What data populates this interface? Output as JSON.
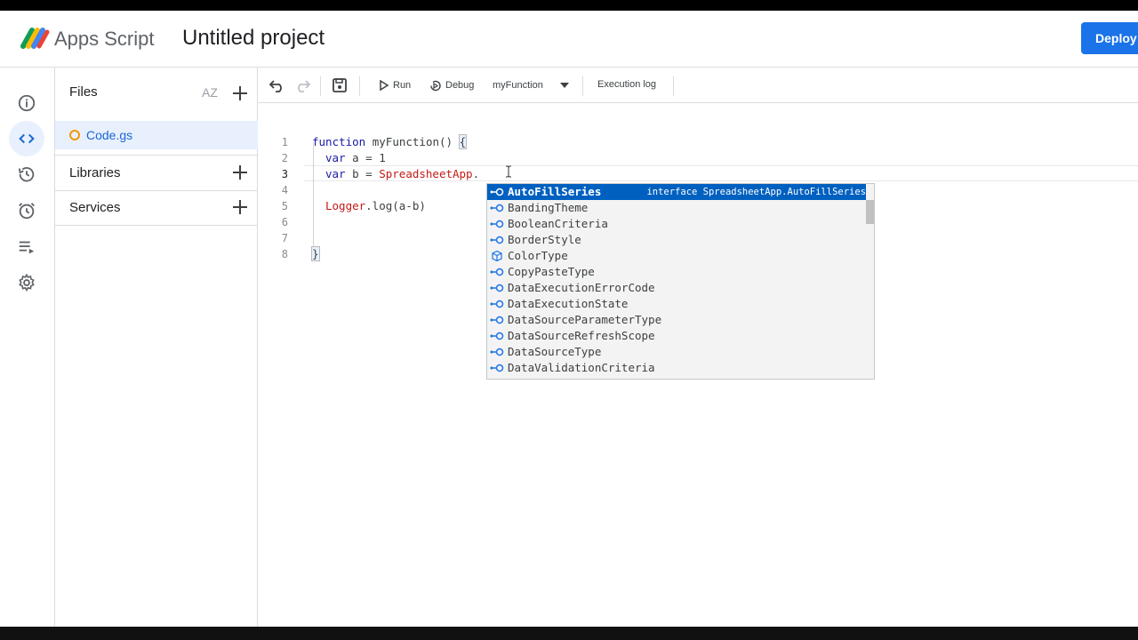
{
  "header": {
    "app_name": "Apps Script",
    "project_title": "Untitled project",
    "deploy_label": "Deploy"
  },
  "rail": {
    "items": [
      {
        "icon": "info-icon"
      },
      {
        "icon": "code-icon",
        "active": true
      },
      {
        "icon": "history-icon"
      },
      {
        "icon": "alarm-icon"
      },
      {
        "icon": "executions-icon"
      },
      {
        "icon": "gear-icon"
      }
    ]
  },
  "files_panel": {
    "files_label": "Files",
    "sort_label": "AZ",
    "file_name": "Code.gs",
    "libraries_label": "Libraries",
    "services_label": "Services"
  },
  "toolbar": {
    "run_label": "Run",
    "debug_label": "Debug",
    "function_select": "myFunction",
    "execution_log_label": "Execution log"
  },
  "editor": {
    "line_numbers": [
      "1",
      "2",
      "3",
      "4",
      "5",
      "6",
      "7",
      "8"
    ],
    "current_line": "3",
    "lines": {
      "l1_kw": "function",
      "l1_rest": " myFunction() ",
      "l1_brace": "{",
      "l2_kw": "var",
      "l2_rest": " a = 1",
      "l3_kw": "var",
      "l3_rest": " b = ",
      "l3_cls": "SpreadsheetApp",
      "l3_dot": ".",
      "l5_cls": "Logger",
      "l5_rest": ".log(a-b)",
      "l8_brace": "}"
    }
  },
  "autocomplete": {
    "items": [
      {
        "label": "AutoFillSeries",
        "detail": "interface SpreadsheetApp.AutoFillSeries",
        "icon": "enum-icon",
        "selected": true
      },
      {
        "label": "BandingTheme",
        "icon": "enum-icon"
      },
      {
        "label": "BooleanCriteria",
        "icon": "enum-icon"
      },
      {
        "label": "BorderStyle",
        "icon": "enum-icon"
      },
      {
        "label": "ColorType",
        "icon": "module-icon"
      },
      {
        "label": "CopyPasteType",
        "icon": "enum-icon"
      },
      {
        "label": "DataExecutionErrorCode",
        "icon": "enum-icon"
      },
      {
        "label": "DataExecutionState",
        "icon": "enum-icon"
      },
      {
        "label": "DataSourceParameterType",
        "icon": "enum-icon"
      },
      {
        "label": "DataSourceRefreshScope",
        "icon": "enum-icon"
      },
      {
        "label": "DataSourceType",
        "icon": "enum-icon"
      },
      {
        "label": "DataValidationCriteria",
        "icon": "enum-icon"
      }
    ]
  },
  "colors": {
    "accent": "#1a73e8",
    "selection": "#0060c0",
    "file_dot": "#f29900"
  }
}
